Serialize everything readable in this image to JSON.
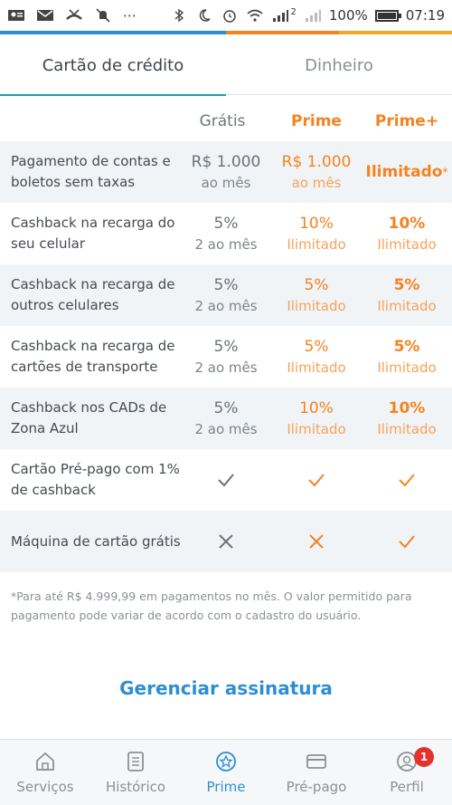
{
  "status_bar": {
    "battery": "100%",
    "time": "07:19",
    "signal_label": "2"
  },
  "colors": {
    "accent_blue": "#2d8fd1",
    "accent_orange": "#f58220",
    "row_alt": "#f1f4f6"
  },
  "tabs": [
    {
      "label": "Cartão de crédito",
      "active": true
    },
    {
      "label": "Dinheiro",
      "active": false
    }
  ],
  "plans": [
    "Grátis",
    "Prime",
    "Prime+"
  ],
  "rows": [
    {
      "label": "Pagamento de contas e boletos sem taxas",
      "cells": [
        {
          "value": "R$ 1.000",
          "sub": "ao mês"
        },
        {
          "value": "R$ 1.000",
          "sub": "ao mês"
        },
        {
          "value": "Ilimitado",
          "sup": "*"
        }
      ]
    },
    {
      "label": "Cashback na recarga do seu celular",
      "cells": [
        {
          "value": "5%",
          "sub": "2 ao mês"
        },
        {
          "value": "10%",
          "sub": "Ilimitado"
        },
        {
          "value": "10%",
          "sub": "Ilimitado"
        }
      ]
    },
    {
      "label": "Cashback na recarga de outros celulares",
      "cells": [
        {
          "value": "5%",
          "sub": "2 ao mês"
        },
        {
          "value": "5%",
          "sub": "Ilimitado"
        },
        {
          "value": "5%",
          "sub": "Ilimitado"
        }
      ]
    },
    {
      "label": "Cashback na recarga de cartões de transporte",
      "cells": [
        {
          "value": "5%",
          "sub": "2 ao mês"
        },
        {
          "value": "5%",
          "sub": "Ilimitado"
        },
        {
          "value": "5%",
          "sub": "Ilimitado"
        }
      ]
    },
    {
      "label": "Cashback nos CADs de Zona Azul",
      "cells": [
        {
          "value": "5%",
          "sub": "2 ao mês"
        },
        {
          "value": "10%",
          "sub": "Ilimitado"
        },
        {
          "value": "10%",
          "sub": "Ilimitado"
        }
      ]
    },
    {
      "label": "Cartão Pré-pago com 1% de cashback",
      "marks": [
        "check",
        "check",
        "check"
      ]
    },
    {
      "label": "Máquina de cartão grátis",
      "marks": [
        "cross",
        "cross",
        "check"
      ]
    }
  ],
  "footnote": "*Para até R$ 4.999,99 em pagamentos no mês. O valor permitido para pagamento pode variar de acordo com o cadastro do usuário.",
  "manage_label": "Gerenciar assinatura",
  "bottom_nav": [
    {
      "label": "Serviços",
      "icon": "home-icon",
      "active": false
    },
    {
      "label": "Histórico",
      "icon": "document-icon",
      "active": false
    },
    {
      "label": "Prime",
      "icon": "star-badge-icon",
      "active": true
    },
    {
      "label": "Pré-pago",
      "icon": "card-icon",
      "active": false
    },
    {
      "label": "Perfil",
      "icon": "profile-icon",
      "active": false,
      "badge": "1"
    }
  ]
}
